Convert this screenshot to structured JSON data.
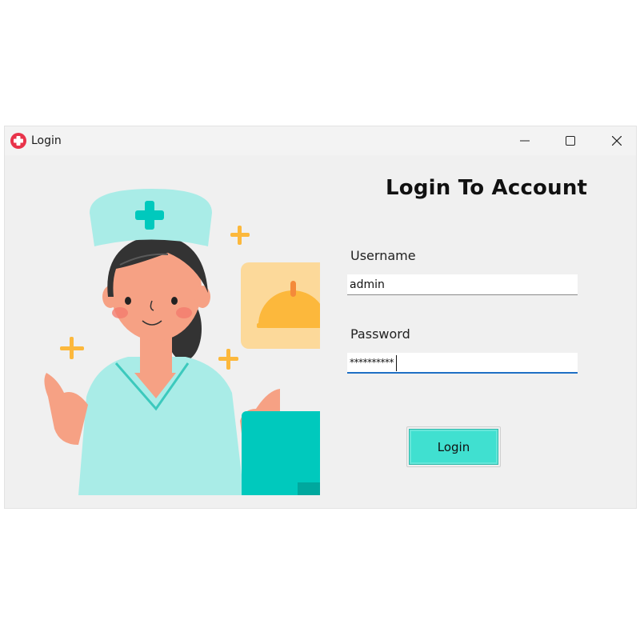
{
  "window": {
    "title": "Login",
    "app_icon": "medical-cross-icon",
    "controls": [
      "minimize-icon",
      "maximize-icon",
      "close-icon"
    ]
  },
  "form": {
    "heading": "Login To Account",
    "username_label": "Username",
    "username_value": "admin",
    "password_label": "Password",
    "password_value": "**********",
    "login_button": "Login"
  },
  "colors": {
    "accent": "#40e0d0",
    "focus": "#1f6fc4",
    "app_icon": "#e8334a",
    "window_bg": "#f0f0f0"
  },
  "illustration": {
    "subject": "nurse-illustration"
  }
}
